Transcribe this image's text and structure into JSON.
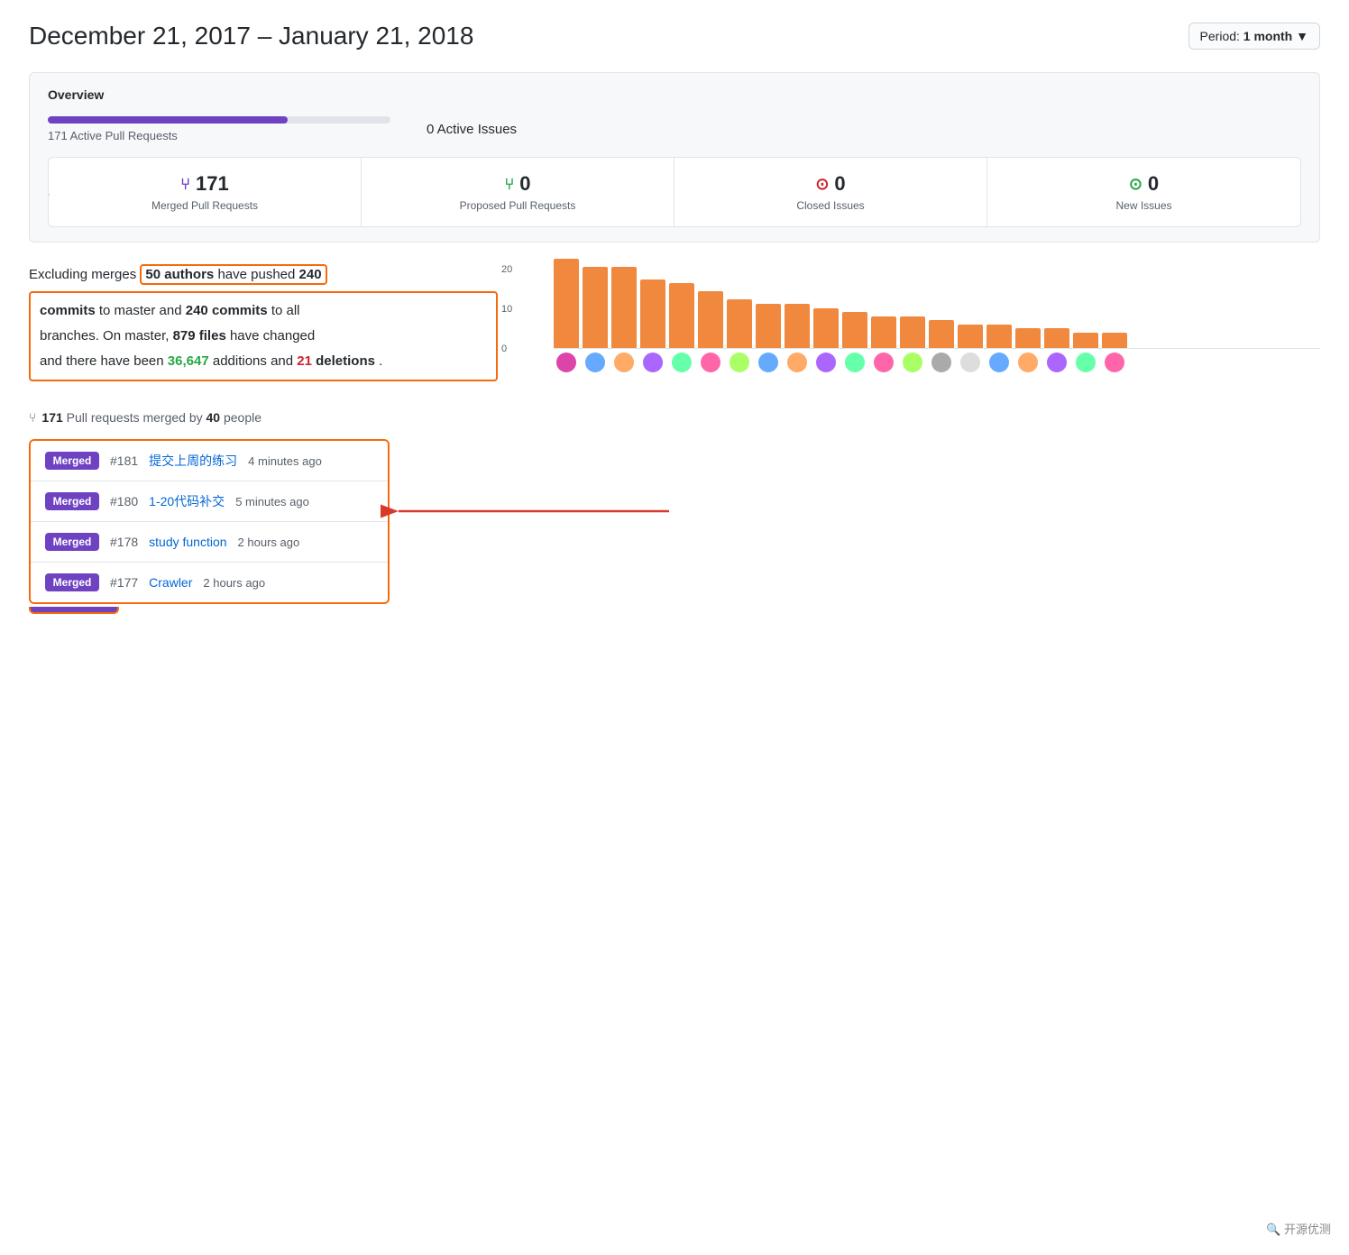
{
  "header": {
    "title": "December 21, 2017 – January 21, 2018",
    "period_label": "Period:",
    "period_value": "1 month",
    "period_dropdown": "▼"
  },
  "overview": {
    "title": "Overview",
    "pull_requests_bar_label": "171 Active Pull Requests",
    "pull_requests_bar_pct": 70,
    "issues_label": "0 Active Issues",
    "issues_bar_pct": 0
  },
  "stats": [
    {
      "id": "merged-prs",
      "icon": "⑂",
      "icon_class": "icon-merged",
      "number": "171",
      "label": "Merged Pull Requests"
    },
    {
      "id": "proposed-prs",
      "icon": "⑂",
      "icon_class": "icon-proposed",
      "number": "0",
      "label": "Proposed Pull Requests"
    },
    {
      "id": "closed-issues",
      "icon": "⊙",
      "icon_class": "icon-closed",
      "number": "0",
      "label": "Closed Issues"
    },
    {
      "id": "new-issues",
      "icon": "⊙",
      "icon_class": "icon-new",
      "number": "0",
      "label": "New Issues"
    }
  ],
  "summary": {
    "prefix": "Excluding merges",
    "highlight1": "50 authors have pushed 240",
    "middle": "commits to master and",
    "commits_all": "240 commits",
    "suffix1": "to all",
    "block2_line1": "branches. On master,",
    "files": "879 files",
    "block2_mid": "have changed",
    "block2_line2": "and there have been",
    "additions": "36,647",
    "additions_suffix": "additions and",
    "deletions": "21",
    "deletions_suffix": "deletions."
  },
  "chart": {
    "y_labels": [
      "20",
      "10",
      "0"
    ],
    "bars": [
      22,
      20,
      20,
      17,
      16,
      14,
      12,
      11,
      11,
      10,
      9,
      8,
      8,
      7,
      6,
      6,
      5,
      5,
      4,
      4
    ],
    "max": 22
  },
  "pr_section": {
    "icon": "⑂",
    "count": "171",
    "label1": "Pull requests merged by",
    "count2": "40",
    "label2": "people"
  },
  "pull_requests": [
    {
      "badge": "Merged",
      "number": "#181",
      "title": "提交上周的练习",
      "time": "4 minutes ago"
    },
    {
      "badge": "Merged",
      "number": "#180",
      "title": "1-20代码补交",
      "time": "5 minutes ago"
    },
    {
      "badge": "Merged",
      "number": "#178",
      "title": "study function",
      "time": "2 hours ago"
    },
    {
      "badge": "Merged",
      "number": "#177",
      "title": "Crawler",
      "time": "2 hours ago"
    }
  ],
  "watermark": "🔍 开源优测"
}
